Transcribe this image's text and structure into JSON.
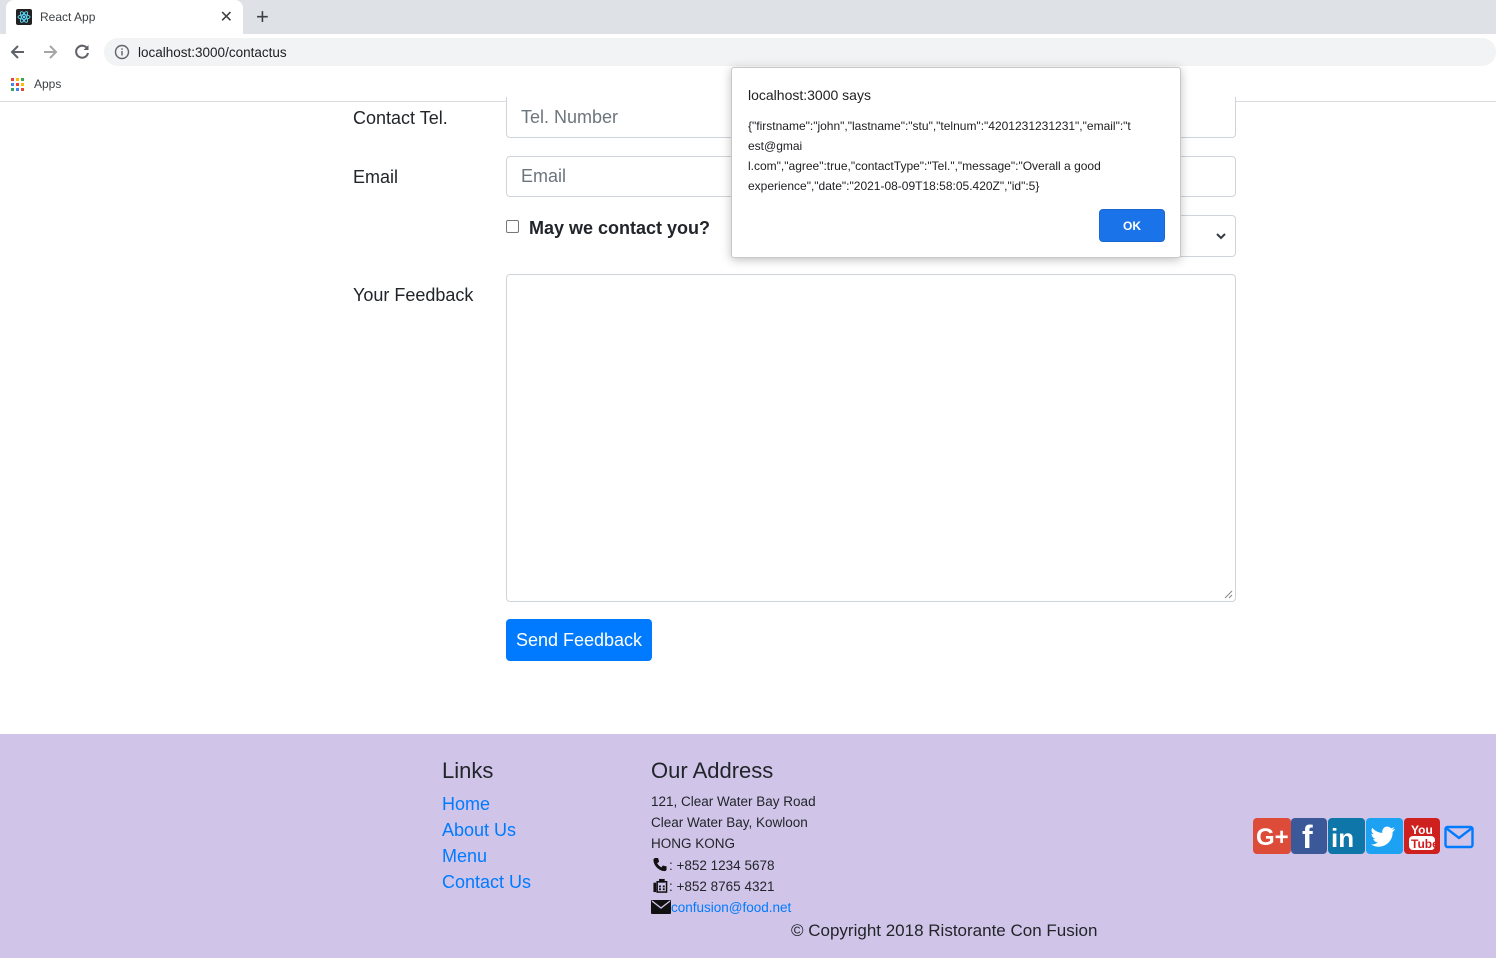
{
  "browser": {
    "tab_title": "React App",
    "url": "localhost:3000/contactus",
    "bookmarks_apps": "Apps"
  },
  "form": {
    "tel_label": "Contact Tel.",
    "tel_placeholder": "Tel. Number",
    "email_label": "Email",
    "email_placeholder": "Email",
    "agree_label": "May we contact you?",
    "feedback_label": "Your Feedback",
    "submit_label": "Send Feedback",
    "agree_checked": false
  },
  "dialog": {
    "title": "localhost:3000 says",
    "message_lines": [
      "{\"firstname\":\"john\",\"lastname\":\"stu\",\"telnum\":\"4201231231231\",\"email\":\"t",
      "est@gmai",
      "l.com\",\"agree\":true,\"contactType\":\"Tel.\",\"message\":\"Overall a good",
      "experience\",\"date\":\"2021-08-09T18:58:05.420Z\",\"id\":5}"
    ],
    "ok_label": "OK"
  },
  "footer": {
    "links_heading": "Links",
    "links": [
      "Home",
      "About Us",
      "Menu",
      "Contact Us"
    ],
    "address_heading": "Our Address",
    "address_lines": [
      "121, Clear Water Bay Road",
      "Clear Water Bay, Kowloon",
      "HONG KONG"
    ],
    "phone": ": +852 1234 5678",
    "fax": ": +852 8765 4321",
    "email": "confusion@food.net",
    "copyright": "© Copyright 2018 Ristorante Con Fusion",
    "social_icons": [
      "google-plus-icon",
      "facebook-icon",
      "linkedin-icon",
      "twitter-icon",
      "youtube-icon",
      "mail-icon"
    ]
  },
  "colors": {
    "primary": "#007bff",
    "footer_bg": "#d1c4e9",
    "dialog_button": "#1a73e8"
  }
}
